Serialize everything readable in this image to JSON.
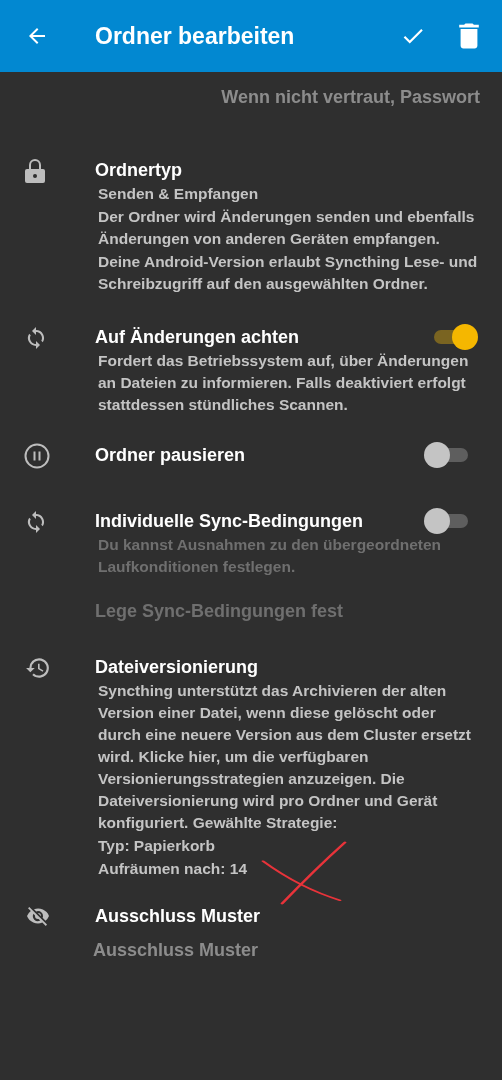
{
  "toolbar": {
    "title": "Ordner bearbeiten"
  },
  "password_hint": "Wenn nicht vertraut, Passwort",
  "settings": [
    {
      "kind": "info",
      "title": "Ordnertyp",
      "lines": [
        "Senden & Empfangen",
        "Der Ordner wird Änderungen senden und ebenfalls Änderungen von anderen Geräten empfangen.",
        "Deine Android-Version erlaubt Syncthing Lese- und Schreibzugriff auf den ausgewählten Ordner."
      ]
    },
    {
      "kind": "toggle",
      "title": "Auf Änderungen achten",
      "on": true,
      "description": "Fordert das Betriebssystem auf, über Änderungen an Dateien zu informieren. Falls deaktiviert erfolgt stattdessen stündliches Scannen."
    },
    {
      "kind": "toggle",
      "title": "Ordner pausieren",
      "on": false
    },
    {
      "kind": "toggle",
      "title": "Individuelle Sync-Bedingungen",
      "on": false,
      "description": "Du kannst Ausnahmen zu den übergeordneten Laufkonditionen festlegen."
    },
    {
      "kind": "link",
      "title": "Lege Sync-Bedingungen fest",
      "disabled": true
    },
    {
      "kind": "info",
      "title": "Dateiversionierung",
      "lines": [
        "Syncthing unterstützt das Archivieren der alten Version einer Datei, wenn diese gelöscht oder durch eine neuere Version aus dem Cluster ersetzt wird. Klicke hier, um die verfügbaren Versionierungsstrategien anzuzeigen. Die Dateiversionierung wird pro Ordner und Gerät konfiguriert. Gewählte Strategie:",
        "Typ: Papierkorb",
        "Aufräumen nach: 14"
      ]
    },
    {
      "kind": "pattern",
      "title": "Ausschluss Muster",
      "value": "Ausschluss Muster"
    }
  ]
}
